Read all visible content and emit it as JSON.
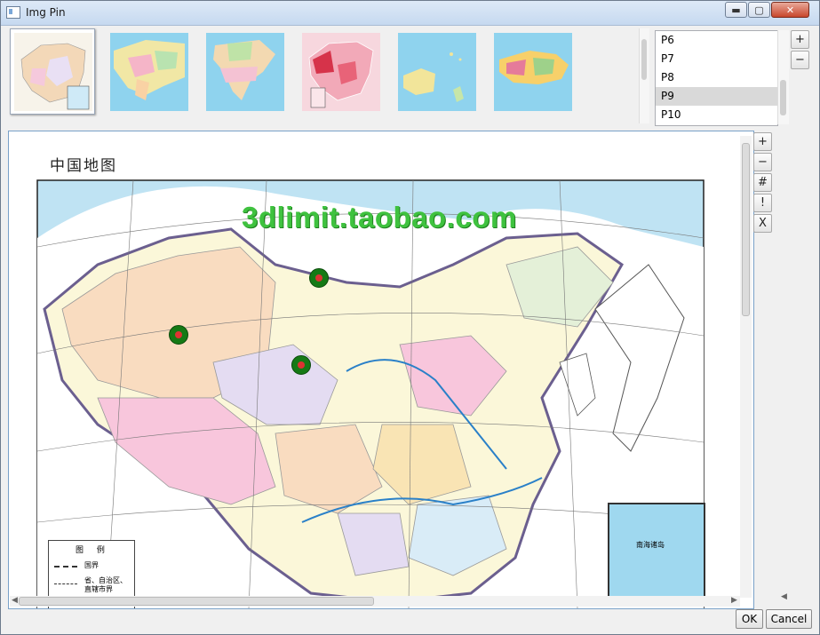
{
  "window": {
    "title": "Img Pin",
    "min": "▬",
    "max": "▢",
    "close": "✕"
  },
  "thumbnails": [
    {
      "name": "China map (light)",
      "bg": "#f7f3ea"
    },
    {
      "name": "Asia map",
      "bg": "#8fd3ee"
    },
    {
      "name": "North America map",
      "bg": "#8fd3ee"
    },
    {
      "name": "China map (red)",
      "bg": "#f7d7de"
    },
    {
      "name": "Oceania map",
      "bg": "#8fd3ee"
    },
    {
      "name": "Africa map",
      "bg": "#8fd3ee"
    }
  ],
  "pin_list": {
    "items": [
      "P6",
      "P7",
      "P8",
      "P9",
      "P10"
    ],
    "selected": "P9",
    "add": "+",
    "remove": "−"
  },
  "view_tools": [
    "+",
    "−",
    "#",
    "!",
    "X"
  ],
  "map": {
    "title": "中国地图",
    "watermark": "3dlimit.taobao.com",
    "legend_title": "图 例",
    "legend_items": [
      "国界",
      "省、自治区、直辖市界"
    ],
    "inset_label": "南海诸岛"
  },
  "colors": {
    "pin": "#157a15",
    "accent": "#79a1c8"
  },
  "buttons": {
    "ok": "OK",
    "cancel": "Cancel"
  }
}
